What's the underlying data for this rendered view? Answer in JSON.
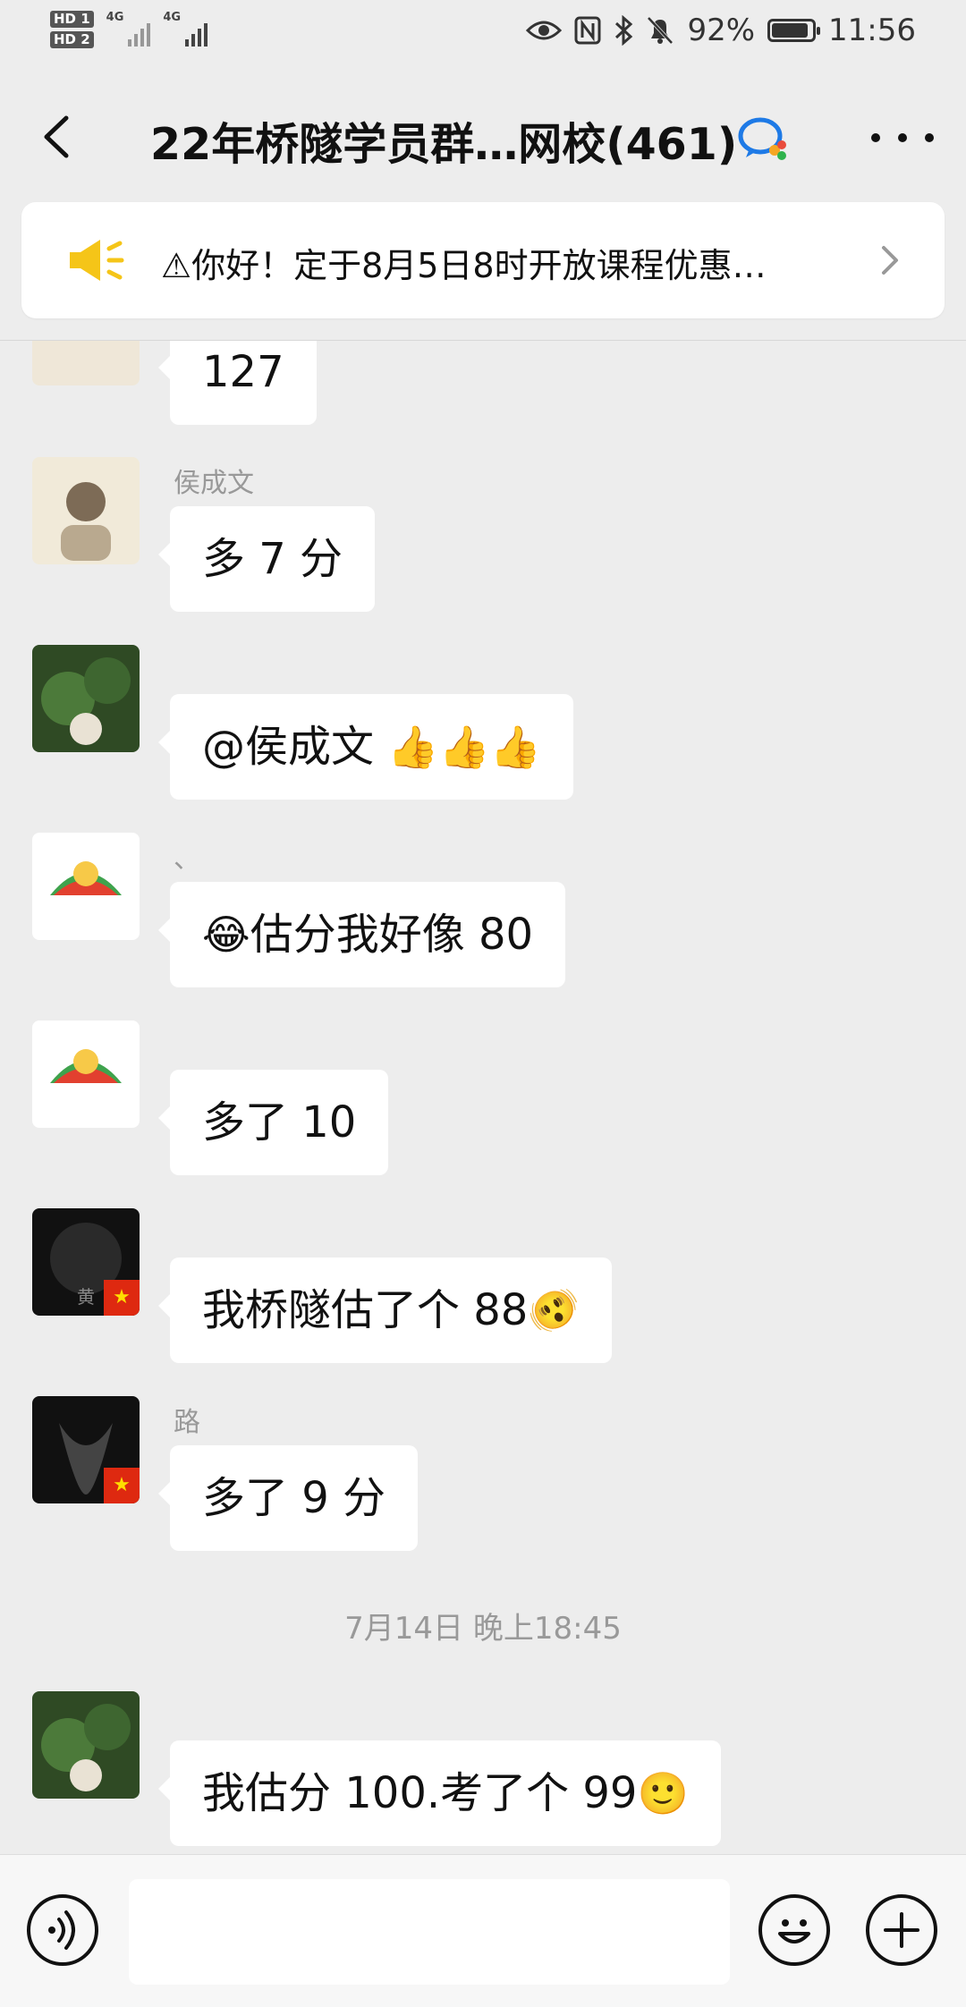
{
  "status_bar": {
    "hd1": "HD 1",
    "hd2": "HD 2",
    "signal1": "4G",
    "signal2": "4G",
    "battery_percent": "92%",
    "battery_level": 0.92,
    "time": "11:56"
  },
  "header": {
    "title": "22年桥隧学员群…网校(461)"
  },
  "announcement": {
    "text": "⚠你好！定于8月5日8时开放课程优惠…"
  },
  "messages": [
    {
      "sender": "",
      "text": "127"
    },
    {
      "sender": "侯成文",
      "text": "多 7 分"
    },
    {
      "sender": "",
      "text": "@侯成文 "
    },
    {
      "sender": "、",
      "text": "估分我好像 80"
    },
    {
      "sender": "",
      "text": "多了 10"
    },
    {
      "sender": "",
      "text": "我桥隧估了个 88"
    },
    {
      "sender": "路",
      "text": "多了 9 分"
    },
    {
      "sender": "",
      "text": "我估分 100.考了个 99"
    }
  ],
  "time_separator": "7月14日 晚上18:45",
  "avatar_flag_text": "黄",
  "input": {
    "value": ""
  },
  "colors": {
    "background": "#ededed",
    "bubble": "#ffffff",
    "announcement_icon": "#f5c518"
  }
}
